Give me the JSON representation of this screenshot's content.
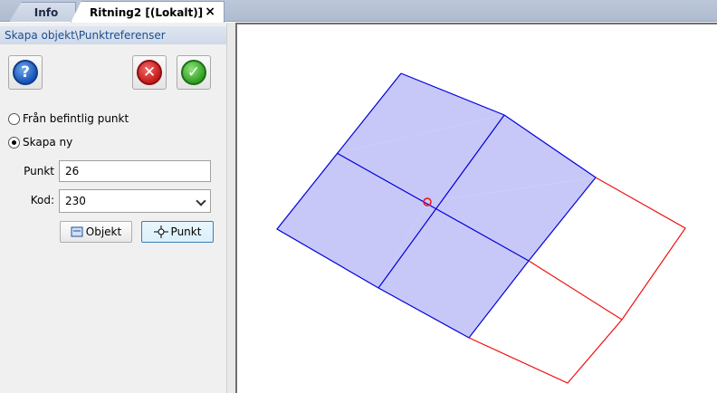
{
  "tabs": [
    {
      "label": "Info",
      "active": false
    },
    {
      "label": "Ritning2 [(Lokalt)]",
      "active": true,
      "close": "×"
    }
  ],
  "panel": {
    "header": "Skapa objekt\\Punktreferenser",
    "toolbar": {
      "help_icon": "help-icon",
      "help_glyph": "?",
      "cancel_icon": "cancel-icon",
      "cancel_glyph": "✕",
      "ok_icon": "ok-icon",
      "ok_glyph": "✓"
    },
    "radio_existing": "Från befintlig punkt",
    "radio_new": "Skapa ny",
    "selected_option": "Skapa ny",
    "punkt_label": "Punkt",
    "punkt_value": "26",
    "kod_label": "Kod:",
    "kod_value": "230",
    "objekt_button": "Objekt",
    "punkt_button": "Punkt"
  },
  "colors": {
    "fill": "#c8c8f8",
    "blue_line": "#0000dd",
    "red_line": "#ee1111",
    "header_text": "#1d4f8e"
  }
}
